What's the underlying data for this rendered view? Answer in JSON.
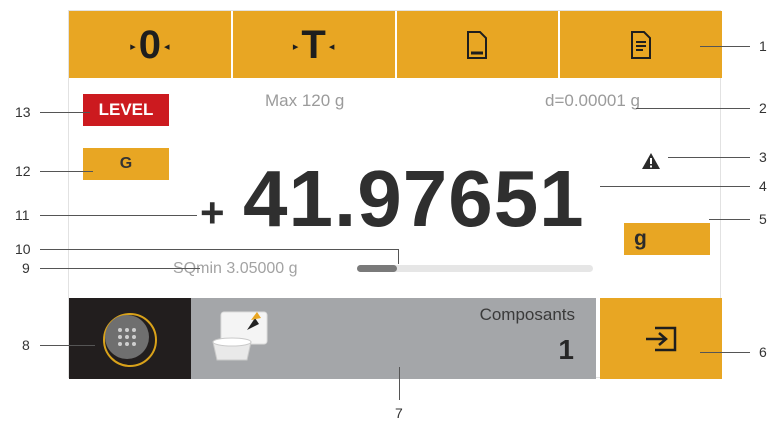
{
  "toolbar": {
    "zero_label": "0",
    "tare_label": "T",
    "doc_icon": "document-icon",
    "report_icon": "report-icon",
    "color": "#e8a623"
  },
  "status": {
    "level_label": "LEVEL",
    "level_color": "#cc1a1f",
    "max_capacity": "Max 120 g",
    "readability": "d=0.00001 g",
    "warning_icon": "warning-triangle-icon"
  },
  "weighing": {
    "g_button_label": "G",
    "sign": "+",
    "value": "41.97651",
    "unit": "g",
    "sqmin_label": "SQmin 3.05000 g",
    "sqmin_progress_pct": 17
  },
  "bottom": {
    "menu_icon": "app-grid-icon",
    "components_icon": "weighing-container-icon",
    "components_label": "Composants",
    "components_count": "1",
    "transfer_icon": "transfer-in-icon",
    "menu_bg": "#221e1e",
    "panel_bg": "#a4a6a9"
  },
  "callouts": [
    "1",
    "2",
    "3",
    "4",
    "5",
    "6",
    "7",
    "8",
    "9",
    "10",
    "11",
    "12",
    "13"
  ]
}
